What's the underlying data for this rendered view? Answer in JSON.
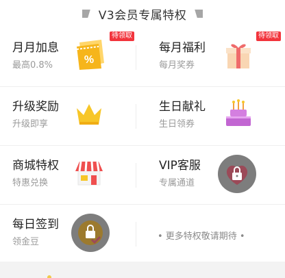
{
  "header": {
    "title": "V3会员专属特权"
  },
  "rows": [
    {
      "left": {
        "name": "月月加息",
        "sub": "最高0.8%",
        "badge": "待领取",
        "icon": "coupon-percent-icon",
        "icon_text": "%"
      },
      "right": {
        "name": "每月福利",
        "sub": "每月奖券",
        "badge": "待领取",
        "icon": "gift-box-icon"
      }
    },
    {
      "left": {
        "name": "升级奖励",
        "sub": "升级即享",
        "icon": "crown-icon"
      },
      "right": {
        "name": "生日献礼",
        "sub": "生日领券",
        "icon": "birthday-cake-icon"
      }
    },
    {
      "left": {
        "name": "商城特权",
        "sub": "特惠兑换",
        "icon": "shop-store-icon"
      },
      "right": {
        "name": "VIP客服",
        "sub": "专属通道",
        "icon": "locked-heart-icon"
      }
    },
    {
      "left": {
        "name": "每日签到",
        "sub": "领金豆",
        "icon": "locked-checkin-icon"
      },
      "right": {
        "more": "• 更多特权敬请期待 •"
      }
    }
  ],
  "colors": {
    "badge": "#f2343c",
    "coupon": "#f6b51b",
    "crown": "#f7c628",
    "gift": "#f9d6b3",
    "cake": "#c266d2",
    "store_awning": "#ef4f4f",
    "lock_circle": "#7d7d7d"
  }
}
